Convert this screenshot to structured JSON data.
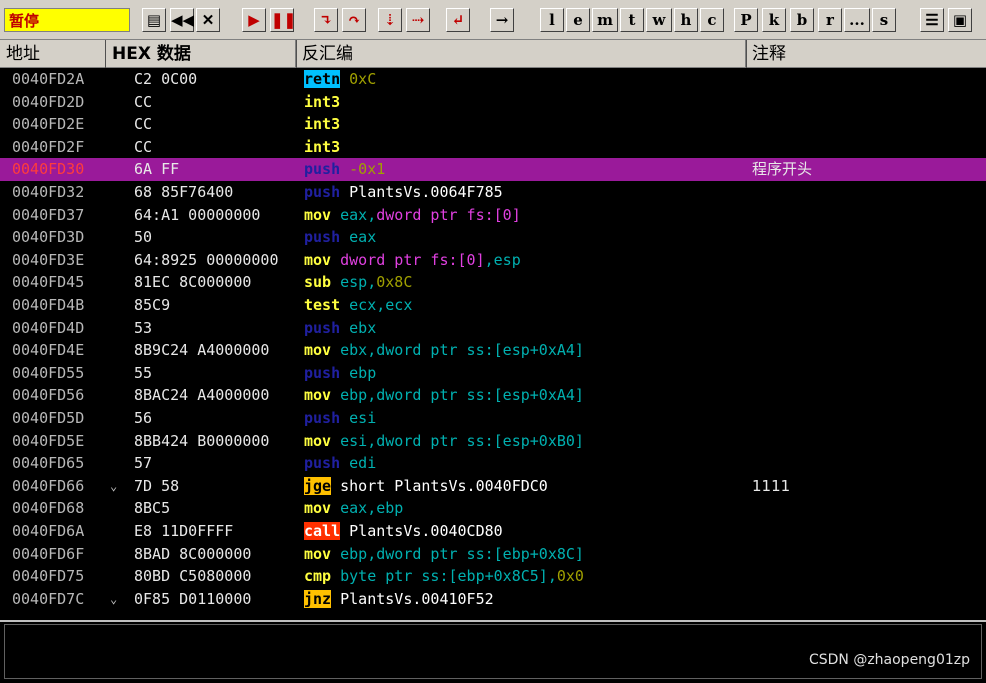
{
  "toolbar": {
    "status": "暂停",
    "letters": [
      "l",
      "e",
      "m",
      "t",
      "w",
      "h",
      "c",
      "P",
      "k",
      "b",
      "r",
      "...",
      "s"
    ]
  },
  "columns": [
    "地址",
    "HEX 数据",
    "反汇编",
    "注释"
  ],
  "colors": {
    "retn": "#00c0ff",
    "int3": "#ffff40",
    "push": "#2020a0",
    "mov": "#ffff40",
    "sub": "#ffff40",
    "test": "#ffff40",
    "jge": "#ffc000",
    "call": "#ff3000",
    "jnz": "#ffc000",
    "cmp": "#ffff40",
    "op_default": "#00b0b0",
    "op_imm": "#a0a000",
    "op_special": "#e040e0",
    "op_white": "#ffffff"
  },
  "rows": [
    {
      "addr": "0040FD2A",
      "hex": "C2 0C00",
      "mnem": "retn",
      "mtype": "retn",
      "ops": [
        {
          "t": "0xC",
          "c": "op_imm"
        }
      ],
      "comment": ""
    },
    {
      "addr": "0040FD2D",
      "hex": "CC",
      "mnem": "int3",
      "mtype": "int3",
      "ops": [],
      "comment": ""
    },
    {
      "addr": "0040FD2E",
      "hex": "CC",
      "mnem": "int3",
      "mtype": "int3",
      "ops": [],
      "comment": ""
    },
    {
      "addr": "0040FD2F",
      "hex": "CC",
      "mnem": "int3",
      "mtype": "int3",
      "ops": [],
      "comment": ""
    },
    {
      "addr": "0040FD30",
      "hex": "6A FF",
      "mnem": "push",
      "mtype": "push",
      "ops": [
        {
          "t": "-0x1",
          "c": "op_imm"
        }
      ],
      "comment": "程序开头",
      "selected": true
    },
    {
      "addr": "0040FD32",
      "hex": "68 85F76400",
      "mnem": "push",
      "mtype": "push",
      "ops": [
        {
          "t": "PlantsVs.0064F785",
          "c": "op_white"
        }
      ],
      "comment": ""
    },
    {
      "addr": "0040FD37",
      "hex": "64:A1 00000000",
      "mnem": "mov",
      "mtype": "mov",
      "ops": [
        {
          "t": "eax,",
          "c": "op_default"
        },
        {
          "t": "dword ptr fs:[0]",
          "c": "op_special"
        }
      ],
      "comment": ""
    },
    {
      "addr": "0040FD3D",
      "hex": "50",
      "mnem": "push",
      "mtype": "push",
      "ops": [
        {
          "t": "eax",
          "c": "op_default"
        }
      ],
      "comment": ""
    },
    {
      "addr": "0040FD3E",
      "hex": "64:8925 00000000",
      "mnem": "mov",
      "mtype": "mov",
      "ops": [
        {
          "t": "dword ptr fs:[0]",
          "c": "op_special"
        },
        {
          "t": ",esp",
          "c": "op_default"
        }
      ],
      "comment": ""
    },
    {
      "addr": "0040FD45",
      "hex": "81EC 8C000000",
      "mnem": "sub",
      "mtype": "sub",
      "ops": [
        {
          "t": "esp,",
          "c": "op_default"
        },
        {
          "t": "0x8C",
          "c": "op_imm"
        }
      ],
      "comment": ""
    },
    {
      "addr": "0040FD4B",
      "hex": "85C9",
      "mnem": "test",
      "mtype": "test",
      "ops": [
        {
          "t": "ecx,ecx",
          "c": "op_default"
        }
      ],
      "comment": ""
    },
    {
      "addr": "0040FD4D",
      "hex": "53",
      "mnem": "push",
      "mtype": "push",
      "ops": [
        {
          "t": "ebx",
          "c": "op_default"
        }
      ],
      "comment": ""
    },
    {
      "addr": "0040FD4E",
      "hex": "8B9C24 A4000000",
      "mnem": "mov",
      "mtype": "mov",
      "ops": [
        {
          "t": "ebx,dword ptr ss:[esp+0xA4]",
          "c": "op_default"
        }
      ],
      "comment": ""
    },
    {
      "addr": "0040FD55",
      "hex": "55",
      "mnem": "push",
      "mtype": "push",
      "ops": [
        {
          "t": "ebp",
          "c": "op_default"
        }
      ],
      "comment": ""
    },
    {
      "addr": "0040FD56",
      "hex": "8BAC24 A4000000",
      "mnem": "mov",
      "mtype": "mov",
      "ops": [
        {
          "t": "ebp,dword ptr ss:[esp+0xA4]",
          "c": "op_default"
        }
      ],
      "comment": ""
    },
    {
      "addr": "0040FD5D",
      "hex": "56",
      "mnem": "push",
      "mtype": "push",
      "ops": [
        {
          "t": "esi",
          "c": "op_default"
        }
      ],
      "comment": ""
    },
    {
      "addr": "0040FD5E",
      "hex": "8BB424 B0000000",
      "mnem": "mov",
      "mtype": "mov",
      "ops": [
        {
          "t": "esi,dword ptr ss:[esp+0xB0]",
          "c": "op_default"
        }
      ],
      "comment": ""
    },
    {
      "addr": "0040FD65",
      "hex": "57",
      "mnem": "push",
      "mtype": "push",
      "ops": [
        {
          "t": "edi",
          "c": "op_default"
        }
      ],
      "comment": ""
    },
    {
      "addr": "0040FD66",
      "hex": "7D 58",
      "mnem": "jge",
      "mtype": "jge",
      "ops": [
        {
          "t": "short PlantsVs.0040FDC0",
          "c": "op_white"
        }
      ],
      "comment": "1111",
      "arrow": true
    },
    {
      "addr": "0040FD68",
      "hex": "8BC5",
      "mnem": "mov",
      "mtype": "mov",
      "ops": [
        {
          "t": "eax,ebp",
          "c": "op_default"
        }
      ],
      "comment": ""
    },
    {
      "addr": "0040FD6A",
      "hex": "E8 11D0FFFF",
      "mnem": "call",
      "mtype": "call",
      "ops": [
        {
          "t": "PlantsVs.0040CD80",
          "c": "op_white"
        }
      ],
      "comment": ""
    },
    {
      "addr": "0040FD6F",
      "hex": "8BAD 8C000000",
      "mnem": "mov",
      "mtype": "mov",
      "ops": [
        {
          "t": "ebp,dword ptr ss:[ebp+0x8C]",
          "c": "op_default"
        }
      ],
      "comment": ""
    },
    {
      "addr": "0040FD75",
      "hex": "80BD C5080000",
      "mnem": "cmp",
      "mtype": "cmp",
      "ops": [
        {
          "t": "byte ptr ss:[ebp+0x8C5],",
          "c": "op_default"
        },
        {
          "t": "0x0",
          "c": "op_imm"
        }
      ],
      "comment": ""
    },
    {
      "addr": "0040FD7C",
      "hex": "0F85 D0110000",
      "mnem": "jnz",
      "mtype": "jnz",
      "ops": [
        {
          "t": "PlantsVs.00410F52",
          "c": "op_white"
        }
      ],
      "comment": "",
      "arrow": true
    }
  ],
  "watermark": "CSDN @zhaopeng01zp"
}
